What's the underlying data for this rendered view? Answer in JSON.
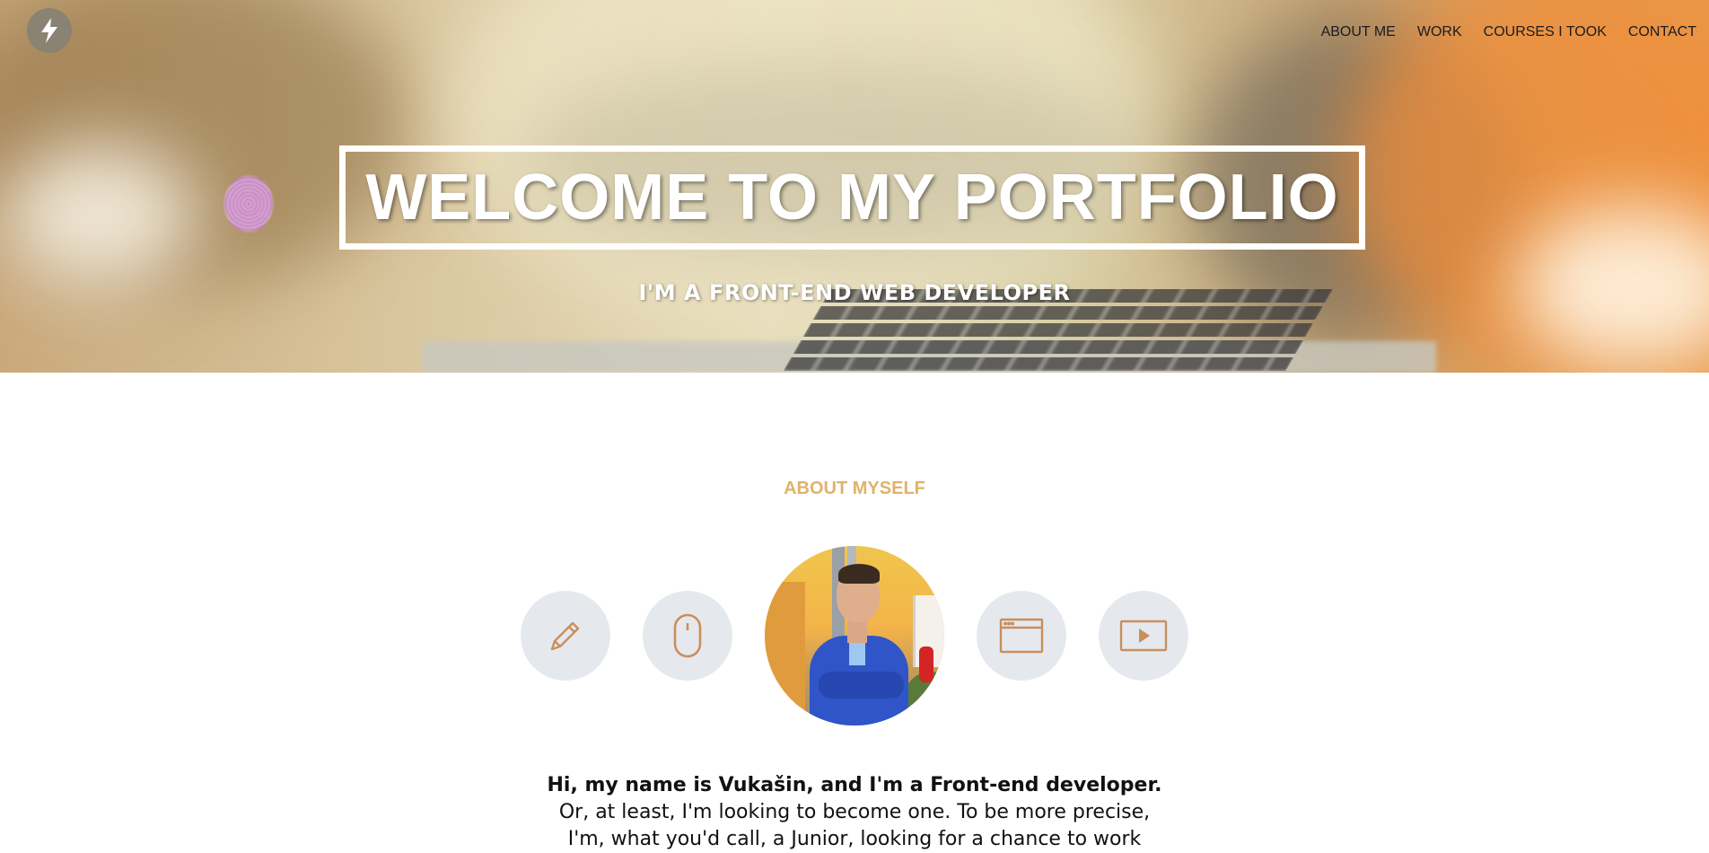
{
  "nav": {
    "items": [
      {
        "label": "ABOUT ME"
      },
      {
        "label": "WORK"
      },
      {
        "label": "COURSES I TOOK"
      },
      {
        "label": "CONTACT"
      }
    ]
  },
  "logo": {
    "icon": "lightning-bolt-icon"
  },
  "hero": {
    "title": "WELCOME TO MY PORTFOLIO",
    "subtitle": "I'M A FRONT-END WEB DEVELOPER"
  },
  "about": {
    "heading": "ABOUT MYSELF",
    "icons": [
      "pencil-icon",
      "mouse-icon",
      "browser-window-icon",
      "play-icon"
    ],
    "avatar_alt": "profile-photo",
    "bio_line1": "Hi, my name is Vukašin, and I'm a Front-end developer.",
    "bio_line2": "Or, at least, I'm looking to become one. To be more precise,",
    "bio_line3": "I'm, what you'd call, a Junior, looking for a chance to work"
  },
  "colors": {
    "accent": "#e0b26a",
    "icon_stroke": "#c98f5b",
    "icon_bg": "#e5e9ee"
  }
}
